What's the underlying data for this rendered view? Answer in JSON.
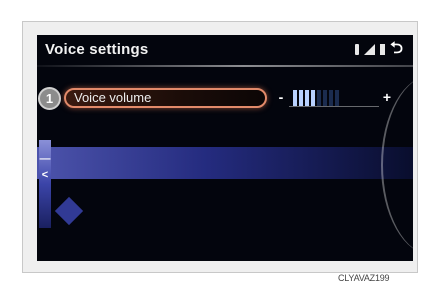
{
  "screen": {
    "title": "Voice settings",
    "back_glyph": "⮌",
    "status_icons": [
      "bluetooth-icon",
      "signal-icon",
      "battery-icon",
      "back-icon"
    ]
  },
  "callout": {
    "number": "1"
  },
  "voice_volume": {
    "label": "Voice volume",
    "minus": "-",
    "plus": "+",
    "level": 4,
    "max_level": 8
  },
  "side_controls": {
    "up": "—",
    "left": "<"
  },
  "caption": "CLYAVAZ199",
  "colors": {
    "highlight_border": "#e28a6a",
    "bar_active": "#b9d2ff",
    "bar_inactive": "#1b2c4f",
    "accent_blue": "#2a3293"
  }
}
